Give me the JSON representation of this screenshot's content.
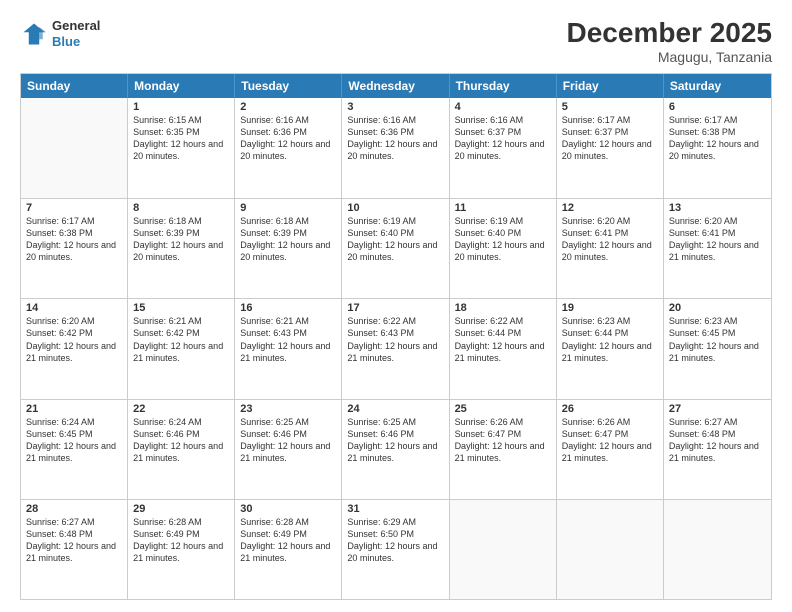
{
  "header": {
    "logo_general": "General",
    "logo_blue": "Blue",
    "month_title": "December 2025",
    "location": "Magugu, Tanzania"
  },
  "weekdays": [
    "Sunday",
    "Monday",
    "Tuesday",
    "Wednesday",
    "Thursday",
    "Friday",
    "Saturday"
  ],
  "weeks": [
    [
      {
        "day": "",
        "sunrise": "",
        "sunset": "",
        "daylight": ""
      },
      {
        "day": "1",
        "sunrise": "Sunrise: 6:15 AM",
        "sunset": "Sunset: 6:35 PM",
        "daylight": "Daylight: 12 hours and 20 minutes."
      },
      {
        "day": "2",
        "sunrise": "Sunrise: 6:16 AM",
        "sunset": "Sunset: 6:36 PM",
        "daylight": "Daylight: 12 hours and 20 minutes."
      },
      {
        "day": "3",
        "sunrise": "Sunrise: 6:16 AM",
        "sunset": "Sunset: 6:36 PM",
        "daylight": "Daylight: 12 hours and 20 minutes."
      },
      {
        "day": "4",
        "sunrise": "Sunrise: 6:16 AM",
        "sunset": "Sunset: 6:37 PM",
        "daylight": "Daylight: 12 hours and 20 minutes."
      },
      {
        "day": "5",
        "sunrise": "Sunrise: 6:17 AM",
        "sunset": "Sunset: 6:37 PM",
        "daylight": "Daylight: 12 hours and 20 minutes."
      },
      {
        "day": "6",
        "sunrise": "Sunrise: 6:17 AM",
        "sunset": "Sunset: 6:38 PM",
        "daylight": "Daylight: 12 hours and 20 minutes."
      }
    ],
    [
      {
        "day": "7",
        "sunrise": "Sunrise: 6:17 AM",
        "sunset": "Sunset: 6:38 PM",
        "daylight": "Daylight: 12 hours and 20 minutes."
      },
      {
        "day": "8",
        "sunrise": "Sunrise: 6:18 AM",
        "sunset": "Sunset: 6:39 PM",
        "daylight": "Daylight: 12 hours and 20 minutes."
      },
      {
        "day": "9",
        "sunrise": "Sunrise: 6:18 AM",
        "sunset": "Sunset: 6:39 PM",
        "daylight": "Daylight: 12 hours and 20 minutes."
      },
      {
        "day": "10",
        "sunrise": "Sunrise: 6:19 AM",
        "sunset": "Sunset: 6:40 PM",
        "daylight": "Daylight: 12 hours and 20 minutes."
      },
      {
        "day": "11",
        "sunrise": "Sunrise: 6:19 AM",
        "sunset": "Sunset: 6:40 PM",
        "daylight": "Daylight: 12 hours and 20 minutes."
      },
      {
        "day": "12",
        "sunrise": "Sunrise: 6:20 AM",
        "sunset": "Sunset: 6:41 PM",
        "daylight": "Daylight: 12 hours and 20 minutes."
      },
      {
        "day": "13",
        "sunrise": "Sunrise: 6:20 AM",
        "sunset": "Sunset: 6:41 PM",
        "daylight": "Daylight: 12 hours and 21 minutes."
      }
    ],
    [
      {
        "day": "14",
        "sunrise": "Sunrise: 6:20 AM",
        "sunset": "Sunset: 6:42 PM",
        "daylight": "Daylight: 12 hours and 21 minutes."
      },
      {
        "day": "15",
        "sunrise": "Sunrise: 6:21 AM",
        "sunset": "Sunset: 6:42 PM",
        "daylight": "Daylight: 12 hours and 21 minutes."
      },
      {
        "day": "16",
        "sunrise": "Sunrise: 6:21 AM",
        "sunset": "Sunset: 6:43 PM",
        "daylight": "Daylight: 12 hours and 21 minutes."
      },
      {
        "day": "17",
        "sunrise": "Sunrise: 6:22 AM",
        "sunset": "Sunset: 6:43 PM",
        "daylight": "Daylight: 12 hours and 21 minutes."
      },
      {
        "day": "18",
        "sunrise": "Sunrise: 6:22 AM",
        "sunset": "Sunset: 6:44 PM",
        "daylight": "Daylight: 12 hours and 21 minutes."
      },
      {
        "day": "19",
        "sunrise": "Sunrise: 6:23 AM",
        "sunset": "Sunset: 6:44 PM",
        "daylight": "Daylight: 12 hours and 21 minutes."
      },
      {
        "day": "20",
        "sunrise": "Sunrise: 6:23 AM",
        "sunset": "Sunset: 6:45 PM",
        "daylight": "Daylight: 12 hours and 21 minutes."
      }
    ],
    [
      {
        "day": "21",
        "sunrise": "Sunrise: 6:24 AM",
        "sunset": "Sunset: 6:45 PM",
        "daylight": "Daylight: 12 hours and 21 minutes."
      },
      {
        "day": "22",
        "sunrise": "Sunrise: 6:24 AM",
        "sunset": "Sunset: 6:46 PM",
        "daylight": "Daylight: 12 hours and 21 minutes."
      },
      {
        "day": "23",
        "sunrise": "Sunrise: 6:25 AM",
        "sunset": "Sunset: 6:46 PM",
        "daylight": "Daylight: 12 hours and 21 minutes."
      },
      {
        "day": "24",
        "sunrise": "Sunrise: 6:25 AM",
        "sunset": "Sunset: 6:46 PM",
        "daylight": "Daylight: 12 hours and 21 minutes."
      },
      {
        "day": "25",
        "sunrise": "Sunrise: 6:26 AM",
        "sunset": "Sunset: 6:47 PM",
        "daylight": "Daylight: 12 hours and 21 minutes."
      },
      {
        "day": "26",
        "sunrise": "Sunrise: 6:26 AM",
        "sunset": "Sunset: 6:47 PM",
        "daylight": "Daylight: 12 hours and 21 minutes."
      },
      {
        "day": "27",
        "sunrise": "Sunrise: 6:27 AM",
        "sunset": "Sunset: 6:48 PM",
        "daylight": "Daylight: 12 hours and 21 minutes."
      }
    ],
    [
      {
        "day": "28",
        "sunrise": "Sunrise: 6:27 AM",
        "sunset": "Sunset: 6:48 PM",
        "daylight": "Daylight: 12 hours and 21 minutes."
      },
      {
        "day": "29",
        "sunrise": "Sunrise: 6:28 AM",
        "sunset": "Sunset: 6:49 PM",
        "daylight": "Daylight: 12 hours and 21 minutes."
      },
      {
        "day": "30",
        "sunrise": "Sunrise: 6:28 AM",
        "sunset": "Sunset: 6:49 PM",
        "daylight": "Daylight: 12 hours and 21 minutes."
      },
      {
        "day": "31",
        "sunrise": "Sunrise: 6:29 AM",
        "sunset": "Sunset: 6:50 PM",
        "daylight": "Daylight: 12 hours and 20 minutes."
      },
      {
        "day": "",
        "sunrise": "",
        "sunset": "",
        "daylight": ""
      },
      {
        "day": "",
        "sunrise": "",
        "sunset": "",
        "daylight": ""
      },
      {
        "day": "",
        "sunrise": "",
        "sunset": "",
        "daylight": ""
      }
    ]
  ]
}
